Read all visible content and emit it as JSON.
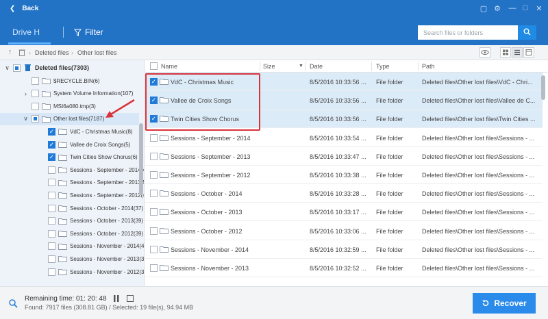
{
  "titlebar": {
    "back_label": "Back"
  },
  "header": {
    "drive_label": "Drive H",
    "filter_label": "Filter",
    "search_placeholder": "Search files or folders"
  },
  "breadcrumb": {
    "items": [
      "Deleted files",
      "Other lost files"
    ]
  },
  "tree": {
    "root": {
      "label": "Deleted files(7303)"
    },
    "items": [
      {
        "label": "$RECYCLE.BIN(6)",
        "checked": "none"
      },
      {
        "label": "System Volume Information(107)",
        "checked": "none"
      },
      {
        "label": "MSI6a080.tmp(3)",
        "checked": "none"
      },
      {
        "label": "Other lost files(7187)",
        "checked": "partial"
      },
      {
        "label": "VdC - Christmas Music(8)",
        "checked": "checked"
      },
      {
        "label": "Vallee de Croix Songs(5)",
        "checked": "checked"
      },
      {
        "label": "Twin Cities Show Chorus(6)",
        "checked": "checked"
      },
      {
        "label": "Sessions - September - 2014(4",
        "checked": "none"
      },
      {
        "label": "Sessions - September - 2013(5",
        "checked": "none"
      },
      {
        "label": "Sessions - September - 2012(4",
        "checked": "none"
      },
      {
        "label": "Sessions - October - 2014(37)",
        "checked": "none"
      },
      {
        "label": "Sessions - October - 2013(39)",
        "checked": "none"
      },
      {
        "label": "Sessions - October - 2012(39)",
        "checked": "none"
      },
      {
        "label": "Sessions - November - 2014(4",
        "checked": "none"
      },
      {
        "label": "Sessions - November - 2013(3",
        "checked": "none"
      },
      {
        "label": "Sessions - November - 2012(3",
        "checked": "none"
      }
    ]
  },
  "list": {
    "columns": [
      "Name",
      "Size",
      "Date",
      "Type",
      "Path"
    ],
    "rows": [
      {
        "name": "VdC - Christmas Music",
        "date": "8/5/2016 10:33:56 ...",
        "type": "File folder",
        "path": "Deleted files\\Other lost files\\VdC - Chri...",
        "checked": true
      },
      {
        "name": "Vallee de Croix Songs",
        "date": "8/5/2016 10:33:56 ...",
        "type": "File folder",
        "path": "Deleted files\\Other lost files\\Vallee de C...",
        "checked": true
      },
      {
        "name": "Twin Cities Show Chorus",
        "date": "8/5/2016 10:33:56 ...",
        "type": "File folder",
        "path": "Deleted files\\Other lost files\\Twin Cities ...",
        "checked": true
      },
      {
        "name": "Sessions - September - 2014",
        "date": "8/5/2016 10:33:54 ...",
        "type": "File folder",
        "path": "Deleted files\\Other lost files\\Sessions - ...",
        "checked": false
      },
      {
        "name": "Sessions - September - 2013",
        "date": "8/5/2016 10:33:47 ...",
        "type": "File folder",
        "path": "Deleted files\\Other lost files\\Sessions - ...",
        "checked": false
      },
      {
        "name": "Sessions - September - 2012",
        "date": "8/5/2016 10:33:38 ...",
        "type": "File folder",
        "path": "Deleted files\\Other lost files\\Sessions - ...",
        "checked": false
      },
      {
        "name": "Sessions - October - 2014",
        "date": "8/5/2016 10:33:28 ...",
        "type": "File folder",
        "path": "Deleted files\\Other lost files\\Sessions - ...",
        "checked": false
      },
      {
        "name": "Sessions - October - 2013",
        "date": "8/5/2016 10:33:17 ...",
        "type": "File folder",
        "path": "Deleted files\\Other lost files\\Sessions - ...",
        "checked": false
      },
      {
        "name": "Sessions - October - 2012",
        "date": "8/5/2016 10:33:06 ...",
        "type": "File folder",
        "path": "Deleted files\\Other lost files\\Sessions - ...",
        "checked": false
      },
      {
        "name": "Sessions - November - 2014",
        "date": "8/5/2016 10:32:59 ...",
        "type": "File folder",
        "path": "Deleted files\\Other lost files\\Sessions - ...",
        "checked": false
      },
      {
        "name": "Sessions - November - 2013",
        "date": "8/5/2016 10:32:52 ...",
        "type": "File folder",
        "path": "Deleted files\\Other lost files\\Sessions - ...",
        "checked": false
      }
    ]
  },
  "footer": {
    "remaining": "Remaining time: 01: 20: 48",
    "found": "Found: 7917 files (308.81 GB) / Selected: 19 file(s), 94.94 MB",
    "recover_label": "Recover"
  },
  "colors": {
    "brand": "#2272c6",
    "accent": "#2a8bea",
    "highlight": "#d8333a"
  }
}
